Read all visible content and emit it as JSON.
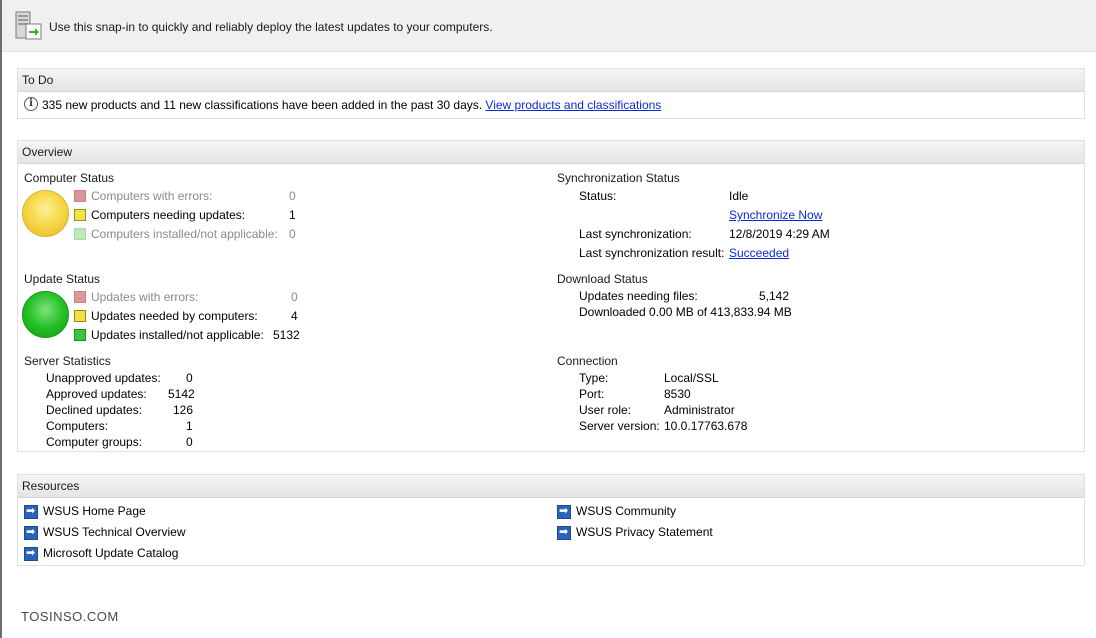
{
  "header": {
    "description": "Use this snap-in to quickly and reliably deploy the latest updates to your computers.",
    "icon": "wsus-server-icon"
  },
  "todo": {
    "title": "To Do",
    "message": "335 new products and 11 new classifications have been added in the past 30 days.",
    "link": "View products and classifications"
  },
  "overview": {
    "title": "Overview",
    "computer_status": {
      "title": "Computer Status",
      "rows": [
        {
          "label": "Computers with errors:",
          "value": "0",
          "color": "#d9999b"
        },
        {
          "label": "Computers needing updates:",
          "value": "1",
          "color": "#f2e24a"
        },
        {
          "label": "Computers installed/not applicable:",
          "value": "0",
          "color": "#bde8bd"
        }
      ]
    },
    "update_status": {
      "title": "Update Status",
      "rows": [
        {
          "label": "Updates with errors:",
          "value": "0",
          "color": "#d9999b"
        },
        {
          "label": "Updates needed by computers:",
          "value": "4",
          "color": "#f2e24a"
        },
        {
          "label": "Updates installed/not applicable:",
          "value": "5132",
          "color": "#3fc43f"
        }
      ]
    },
    "server_statistics": {
      "title": "Server Statistics",
      "rows": [
        {
          "label": "Unapproved updates:",
          "value": "0"
        },
        {
          "label": "Approved updates:",
          "value": "5142"
        },
        {
          "label": "Declined updates:",
          "value": "126"
        },
        {
          "label": "Computers:",
          "value": "1"
        },
        {
          "label": "Computer groups:",
          "value": "0"
        }
      ]
    },
    "sync_status": {
      "title": "Synchronization Status",
      "status_label": "Status:",
      "status_value": "Idle",
      "sync_now_link": "Synchronize Now",
      "last_sync_label": "Last synchronization:",
      "last_sync_value": "12/8/2019 4:29 AM",
      "last_result_label": "Last synchronization result:",
      "last_result_link": "Succeeded"
    },
    "download_status": {
      "title": "Download Status",
      "needing_label": "Updates needing files:",
      "needing_value": "5,142",
      "downloaded": "Downloaded 0.00 MB of 413,833.94 MB"
    },
    "connection": {
      "title": "Connection",
      "rows": [
        {
          "label": "Type:",
          "value": "Local/SSL"
        },
        {
          "label": "Port:",
          "value": "8530"
        },
        {
          "label": "User role:",
          "value": "Administrator"
        },
        {
          "label": "Server version:",
          "value": "10.0.17763.678"
        }
      ]
    }
  },
  "resources": {
    "title": "Resources",
    "links": [
      "WSUS Home Page",
      "WSUS Technical Overview",
      "Microsoft Update Catalog",
      "WSUS Community",
      "WSUS Privacy Statement"
    ]
  },
  "watermark": "TOSINSO.COM"
}
